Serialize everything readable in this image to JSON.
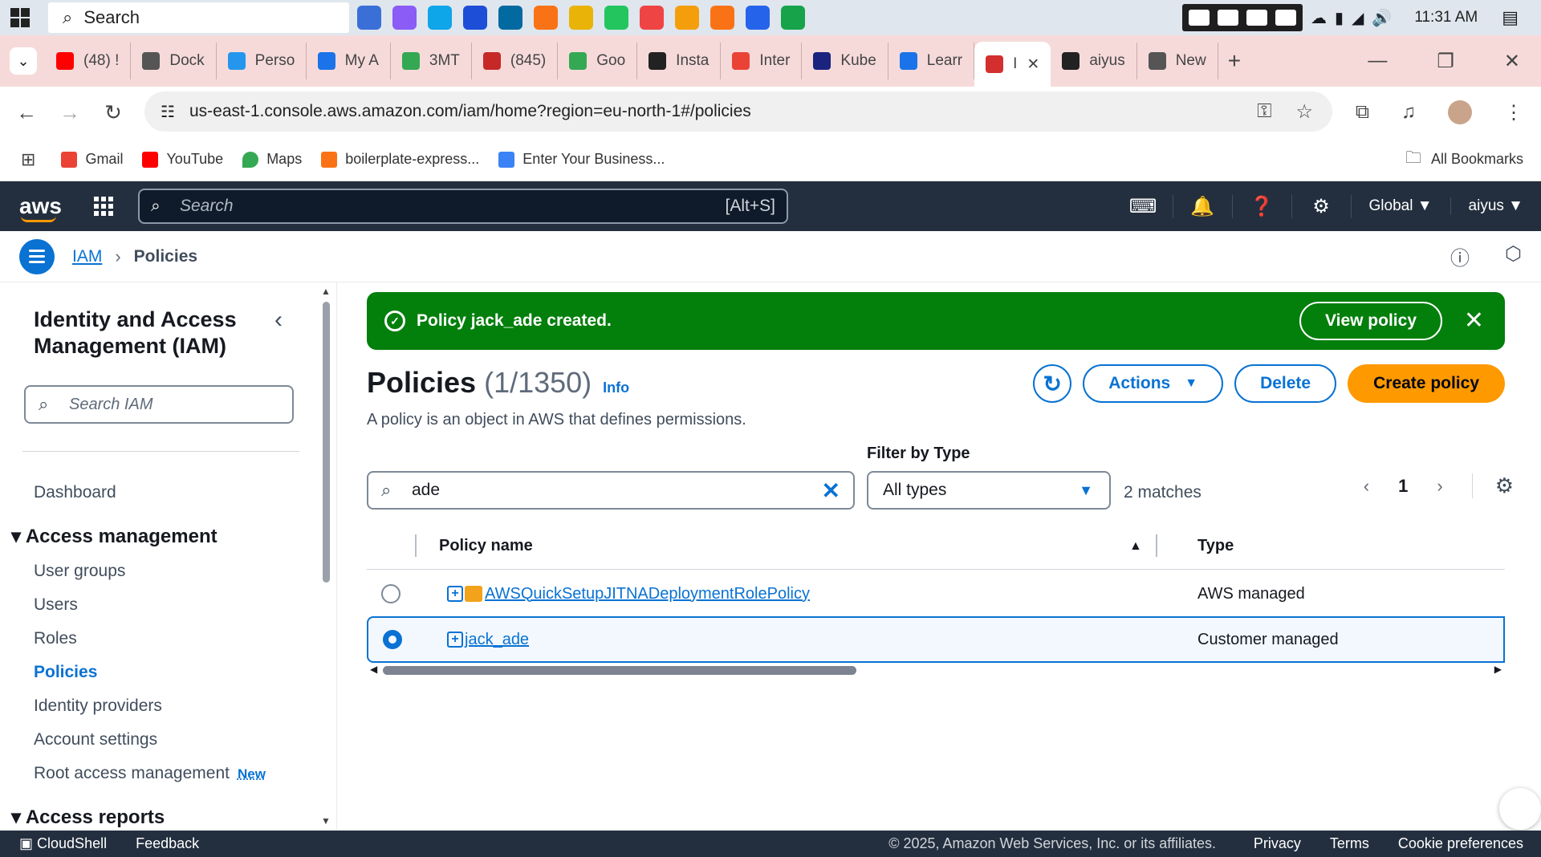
{
  "taskbar": {
    "search_placeholder": "Search",
    "time": "11:31 AM"
  },
  "browser": {
    "tabs": [
      {
        "label": "(48) !",
        "color": "#ff0000"
      },
      {
        "label": "Dock",
        "color": "#555555"
      },
      {
        "label": "Perso",
        "color": "#2496ed"
      },
      {
        "label": "My A",
        "color": "#1a73e8"
      },
      {
        "label": "3MT",
        "color": "#34a853"
      },
      {
        "label": "(845)",
        "color": "#c62828"
      },
      {
        "label": "Goo",
        "color": "#34a853"
      },
      {
        "label": "Insta",
        "color": "#222222"
      },
      {
        "label": "Inter",
        "color": "#ea4335"
      },
      {
        "label": "Kube",
        "color": "#1a237e"
      },
      {
        "label": "Learr",
        "color": "#1a73e8"
      },
      {
        "label": "I",
        "color": "#d32f2f",
        "active": true
      },
      {
        "label": "aiyus",
        "color": "#222222"
      },
      {
        "label": "New",
        "color": "#555555"
      }
    ],
    "url": "us-east-1.console.aws.amazon.com/iam/home?region=eu-north-1#/policies",
    "bookmarks": [
      "Gmail",
      "YouTube",
      "Maps",
      "boilerplate-express...",
      "Enter Your Business..."
    ],
    "all_bookmarks": "All Bookmarks"
  },
  "aws": {
    "search_placeholder": "Search",
    "search_shortcut": "[Alt+S]",
    "region": "Global",
    "user": "aiyus"
  },
  "breadcrumb": {
    "root": "IAM",
    "current": "Policies"
  },
  "sidebar": {
    "title": "Identity and Access Management (IAM)",
    "search_placeholder": "Search IAM",
    "dashboard": "Dashboard",
    "section_access_management": "Access management",
    "items": [
      "User groups",
      "Users",
      "Roles",
      "Policies",
      "Identity providers",
      "Account settings",
      "Root access management"
    ],
    "new_badge": "New",
    "section_access_reports": "Access reports"
  },
  "flash": {
    "message": "Policy jack_ade created.",
    "view_button": "View policy"
  },
  "page": {
    "title": "Policies",
    "count": "(1/1350)",
    "info": "Info",
    "description": "A policy is an object in AWS that defines permissions.",
    "actions_button": "Actions",
    "delete_button": "Delete",
    "create_button": "Create policy"
  },
  "filter": {
    "query": "ade",
    "type_label": "Filter by Type",
    "type_value": "All types",
    "matches": "2 matches",
    "page": "1"
  },
  "table": {
    "columns": [
      "Policy name",
      "Type"
    ],
    "rows": [
      {
        "name": "AWSQuickSetupJITNADeploymentRolePolicy",
        "type": "AWS managed",
        "selected": false
      },
      {
        "name": "jack_ade",
        "type": "Customer managed",
        "selected": true
      }
    ]
  },
  "footer": {
    "cloudshell": "CloudShell",
    "feedback": "Feedback",
    "copyright": "© 2025, Amazon Web Services, Inc. or its affiliates.",
    "links": [
      "Privacy",
      "Terms",
      "Cookie preferences"
    ]
  }
}
